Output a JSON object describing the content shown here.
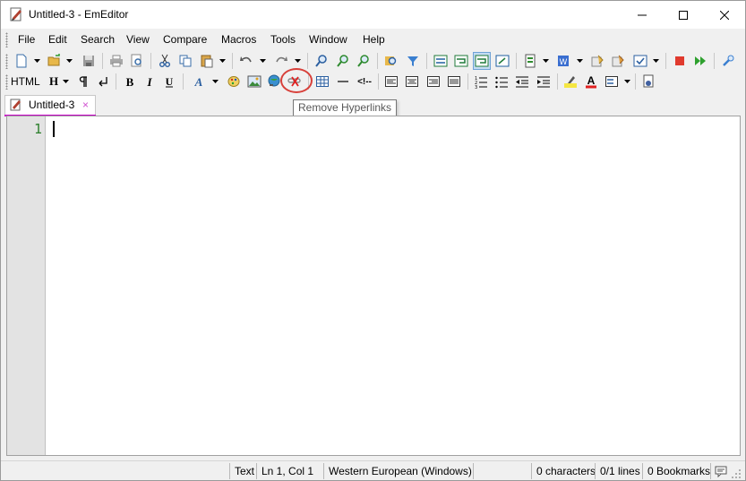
{
  "window": {
    "title": "Untitled-3 - EmEditor"
  },
  "menu": {
    "items": [
      "File",
      "Edit",
      "Search",
      "View",
      "Compare",
      "Macros",
      "Tools",
      "Window",
      "Help"
    ]
  },
  "html_toolbar": {
    "html_label": "HTML",
    "heading_label": "H",
    "comment_label": "<!--"
  },
  "tooltip": {
    "text": "Remove Hyperlinks"
  },
  "tabs": [
    {
      "label": "Untitled-3",
      "close": "×"
    }
  ],
  "editor": {
    "line_number": "1"
  },
  "status": {
    "mode": "Text",
    "position": "Ln 1, Col 1",
    "encoding": "Western European (Windows)",
    "characters": "0 characters",
    "lines": "0/1 lines",
    "bookmarks": "0 Bookmarks"
  },
  "colors": {
    "accent_tab": "#c800c8",
    "highlight_ring": "#d8403a",
    "line_number": "#2b7f2b"
  }
}
